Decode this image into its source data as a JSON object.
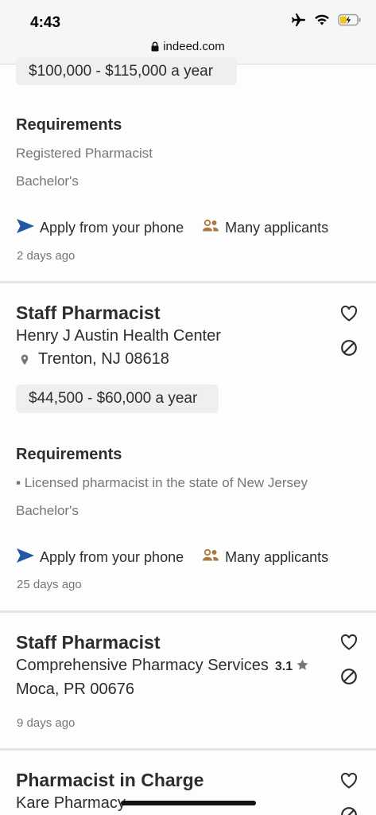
{
  "status_bar": {
    "time": "4:43",
    "url": "indeed.com"
  },
  "colors": {
    "apply_arrow": "#2557a7",
    "applicants_icon": "#a97a3f",
    "text": "#2d2d2d",
    "muted": "#767676"
  },
  "jobs": [
    {
      "salary": "$100,000 - $115,000 a year",
      "requirements_heading": "Requirements",
      "requirements": [
        "Registered Pharmacist",
        "Bachelor's"
      ],
      "apply_label": "Apply from your phone",
      "applicants_label": "Many applicants",
      "posted": "2 days ago"
    },
    {
      "title": "Staff Pharmacist",
      "company": "Henry J Austin Health Center",
      "location": "Trenton, NJ 08618",
      "salary": "$44,500 - $60,000 a year",
      "requirements_heading": "Requirements",
      "requirements": [
        "▪ Licensed pharmacist in the state of New Jersey",
        "Bachelor's"
      ],
      "apply_label": "Apply from your phone",
      "applicants_label": "Many applicants",
      "posted": "25 days ago"
    },
    {
      "title": "Staff Pharmacist",
      "company": "Comprehensive Pharmacy Services",
      "rating": "3.1",
      "location": "Moca, PR 00676",
      "posted": "9 days ago"
    },
    {
      "title": "Pharmacist in Charge",
      "company": "Kare Pharmacy"
    }
  ],
  "icons": {
    "save": "heart-icon",
    "hide": "block-icon",
    "location": "map-pin-icon",
    "apply": "send-arrow-icon",
    "applicants": "people-icon",
    "rating": "star-icon"
  }
}
